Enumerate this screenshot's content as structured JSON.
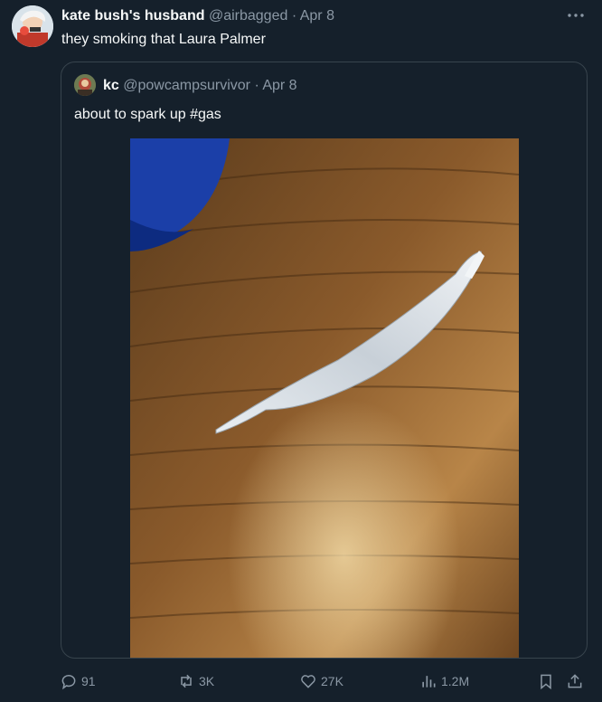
{
  "author": {
    "display_name": "kate bush's husband",
    "handle": "@airbagged",
    "separator": "·",
    "date": "Apr 8",
    "text": "they smoking that Laura Palmer"
  },
  "quoted": {
    "display_name": "kc",
    "handle": "@powcampsurvivor",
    "separator": "·",
    "date": "Apr 8",
    "text": "about to spark up #gas"
  },
  "actions": {
    "replies": "91",
    "reposts": "3K",
    "likes": "27K",
    "views": "1.2M"
  },
  "icons": [
    "more-icon",
    "reply-icon",
    "repost-icon",
    "like-icon",
    "views-icon",
    "bookmark-icon",
    "share-icon"
  ],
  "colors": {
    "background": "#15202b",
    "text": "#f7f9f9",
    "muted": "#8b98a5",
    "border": "#38444d"
  }
}
